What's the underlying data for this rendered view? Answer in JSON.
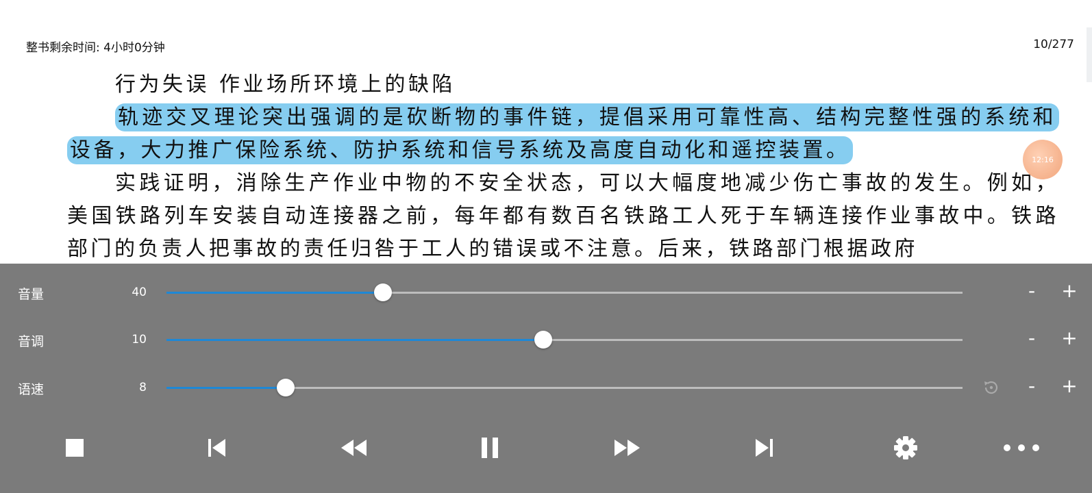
{
  "header": {
    "remaining_time": "整书剩余时间: 4小时0分钟",
    "page_counter": "10/277"
  },
  "content": {
    "line_heading": "行为失误 作业场所环境上的缺陷",
    "highlighted_paragraph": "轨迹交叉理论突出强调的是砍断物的事件链，提倡采用可靠性高、结构完整性强的系统和设备，大力推广保险系统、防护系统和信号系统及高度自动化和遥控装置。",
    "paragraph_3": "实践证明，消除生产作业中物的不安全状态，可以大幅度地减少伤亡事故的发生。例如，美国铁路列车安装自动连接器之前，每年都有数百名铁路工人死于车辆连接作业事故中。铁路部门的负责人把事故的责任归咎于工人的错误或不注意。后来，铁路部门根据政府"
  },
  "floating_clock": "12:16",
  "tts_panel": {
    "volume": {
      "label": "音量",
      "value": "40",
      "fraction": 0.272
    },
    "pitch": {
      "label": "音调",
      "value": "10",
      "fraction": 0.473
    },
    "speed": {
      "label": "语速",
      "value": "8",
      "fraction": 0.15
    },
    "minus_label": "-",
    "plus_label": "+"
  },
  "controls": [
    "stop-icon",
    "skip-previous-icon",
    "rewind-icon",
    "pause-icon",
    "fast-forward-icon",
    "skip-next-icon",
    "settings-icon",
    "more-icon"
  ],
  "colors": {
    "highlight": "#86cdf0",
    "panel": "#7b7b7b",
    "slider_fill": "#1e88d6",
    "slider_track": "#bdbdbd"
  }
}
